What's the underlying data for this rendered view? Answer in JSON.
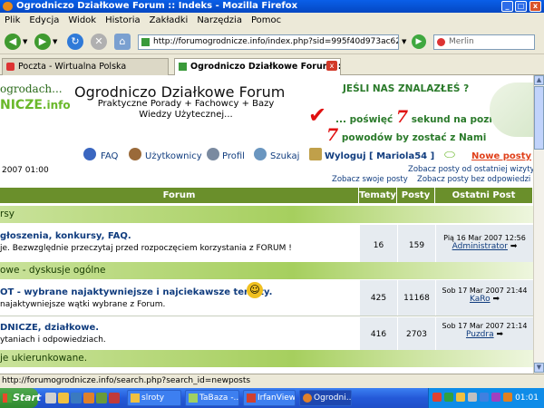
{
  "window": {
    "title": "Ogrodniczo Działkowe Forum :: Indeks - Mozilla Firefox"
  },
  "menubar": [
    "Plik",
    "Edycja",
    "Widok",
    "Historia",
    "Zakładki",
    "Narzędzia",
    "Pomoc"
  ],
  "navbar": {
    "url": "http://forumogrodnicze.info/index.php?sid=995f40d973ac62847423",
    "search_placeholder": "Merlin"
  },
  "tabs": [
    {
      "label": "Poczta - Wirtualna Polska"
    },
    {
      "label": "Ogrodniczo Działkowe Forum :: In..."
    }
  ],
  "site": {
    "logo_line1": "ogrodach...",
    "logo_line2": "NICZE",
    "logo_ext": ".info",
    "title": "Ogrodniczo Działkowe Forum",
    "tagline": "Praktyczne Porady + Fachowcy + Bazy Wiedzy Użytecznej...",
    "promo1": "JEŚLI NAS ZNALAZŁEŚ ?",
    "promo2_pre": "... poświęć",
    "promo2_num": "7",
    "promo2_post": "sekund na poznanie",
    "promo3_num": "7",
    "promo3_post": "powodów by zostać z Nami"
  },
  "nav": {
    "faq": "FAQ",
    "users": "Użytkownicy",
    "profile": "Profil",
    "search": "Szukaj",
    "logout": "Wyloguj [ Mariola54 ]",
    "new_posts": "Nowe posty"
  },
  "datetime": "2007 01:00",
  "links": {
    "since_last": "Zobacz posty od ostatniej wizyty",
    "own_posts": "Zobacz swoje posty",
    "unanswered": "Zobacz posty bez odpowiedzi"
  },
  "table": {
    "headers": [
      "Forum",
      "Tematy",
      "Posty",
      "Ostatni Post"
    ],
    "categories": [
      {
        "name": "rsy"
      },
      {
        "name": "owe - dyskusje ogólne"
      },
      {
        "name": "je ukierunkowane."
      }
    ],
    "rows": [
      {
        "title": "głoszenia, konkursy, FAQ.",
        "desc": "je. Bezwzględnie przeczytaj przed rozpoczęciem korzystania z FORUM !",
        "topics": "16",
        "posts": "159",
        "last_date": "Pią 16 Mar 2007 12:56",
        "last_user": "Administrator"
      },
      {
        "title": "OT - wybrane najaktywniejsze i najciekawsze tematy.",
        "desc": "najaktywniejsze wątki wybrane z Forum.",
        "topics": "425",
        "posts": "11168",
        "last_date": "Sob 17 Mar 2007 21:44",
        "last_user": "KaRo"
      },
      {
        "title": "DNICZE, działkowe.",
        "desc": "ytaniach i odpowiedziach.",
        "topics": "416",
        "posts": "2703",
        "last_date": "Sob 17 Mar 2007 21:14",
        "last_user": "Puzdra"
      }
    ]
  },
  "status": "http://forumogrodnicze.info/search.php?search_id=newposts",
  "taskbar": {
    "start": "Start",
    "items": [
      {
        "label": "slroty"
      },
      {
        "label": "TaBaza -..."
      },
      {
        "label": "IrfanView"
      },
      {
        "label": "Ogrodni..."
      }
    ],
    "clock": "01:01"
  },
  "colors": {
    "header_green": "#6a8f2b",
    "link_blue": "#103c7e",
    "category_green": "#a6cf5e"
  }
}
